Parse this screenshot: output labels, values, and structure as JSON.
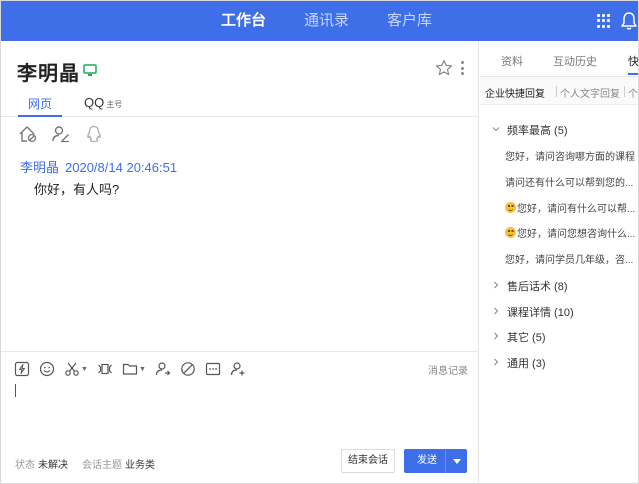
{
  "topnav": {
    "tabs": [
      {
        "label": "工作台",
        "active": true
      },
      {
        "label": "通讯录",
        "active": false
      },
      {
        "label": "客户库",
        "active": false
      }
    ],
    "dialpad_icon": "dialpad-icon",
    "bell_icon": "bell-icon"
  },
  "contact": {
    "name": "李明晶",
    "device_icon": "desktop-icon",
    "channel_tabs": {
      "web": "网页",
      "qq": "QQ",
      "qq_tag": "主号"
    }
  },
  "conversation": {
    "message": {
      "sender": "李明晶",
      "timestamp": "2020/8/14 20:46:51",
      "text": "你好，有人吗?"
    }
  },
  "composer": {
    "history_link": "消息记录",
    "status_label": "状态",
    "status_value": "未解决",
    "topic_label": "会话主题",
    "topic_value": "业务类",
    "end_button": "结束会话",
    "send_button": "发送"
  },
  "side_panel": {
    "tabs": [
      "资料",
      "互动历史",
      "快"
    ],
    "subtabs": [
      "企业快捷回复",
      "个人文字回复",
      "个"
    ],
    "groups": [
      {
        "label": "频率最高 (5)",
        "expanded": true,
        "items": [
          {
            "text": "您好，请问咨询哪方面的课程",
            "emoji": false
          },
          {
            "text": "请问还有什么可以帮到您的...",
            "emoji": false
          },
          {
            "text": "您好，请问有什么可以帮...",
            "emoji": true
          },
          {
            "text": "您好，请问您想咨询什么...",
            "emoji": true
          },
          {
            "text": "您好，请问学员几年级，咨...",
            "emoji": false
          }
        ]
      },
      {
        "label": "售后话术 (8)",
        "expanded": false
      },
      {
        "label": "课程详情 (10)",
        "expanded": false
      },
      {
        "label": "其它 (5)",
        "expanded": false
      },
      {
        "label": "通用 (3)",
        "expanded": false
      }
    ]
  },
  "colors": {
    "brand": "#3e6ee8",
    "topbar": "#3e6ee8",
    "online": "#1aaa55"
  }
}
